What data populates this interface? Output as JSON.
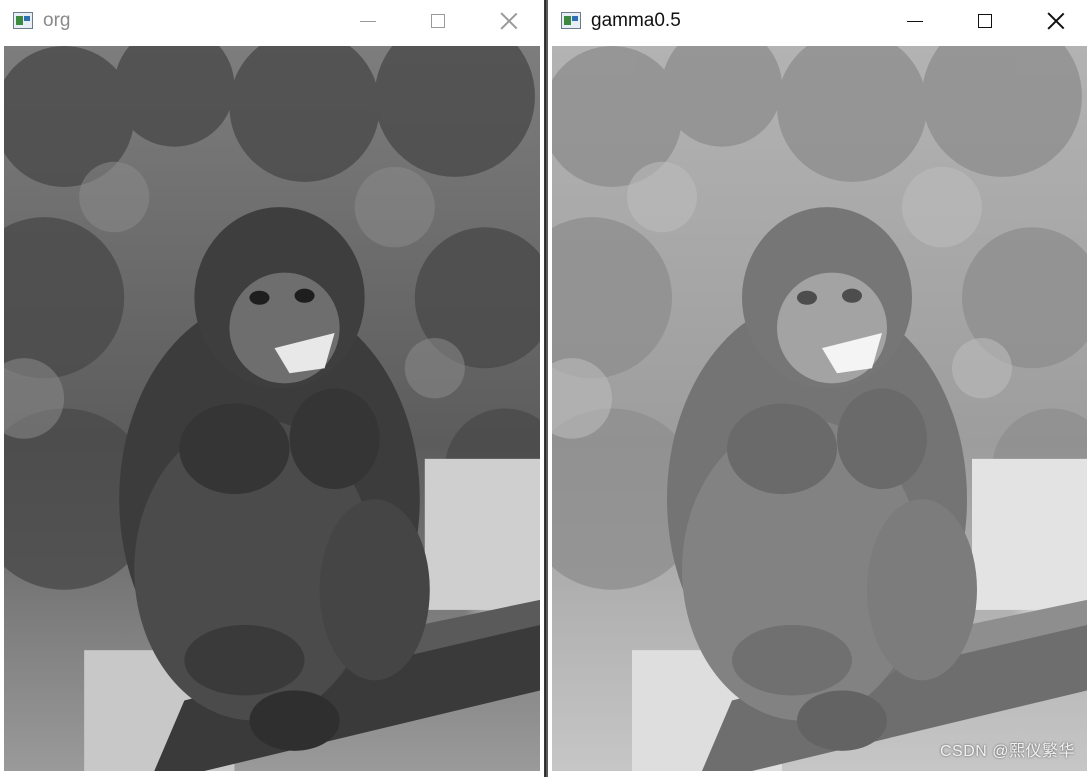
{
  "windows": [
    {
      "title": "org"
    },
    {
      "title": "gamma0.5"
    }
  ],
  "watermark": "CSDN @熙仪繁华"
}
